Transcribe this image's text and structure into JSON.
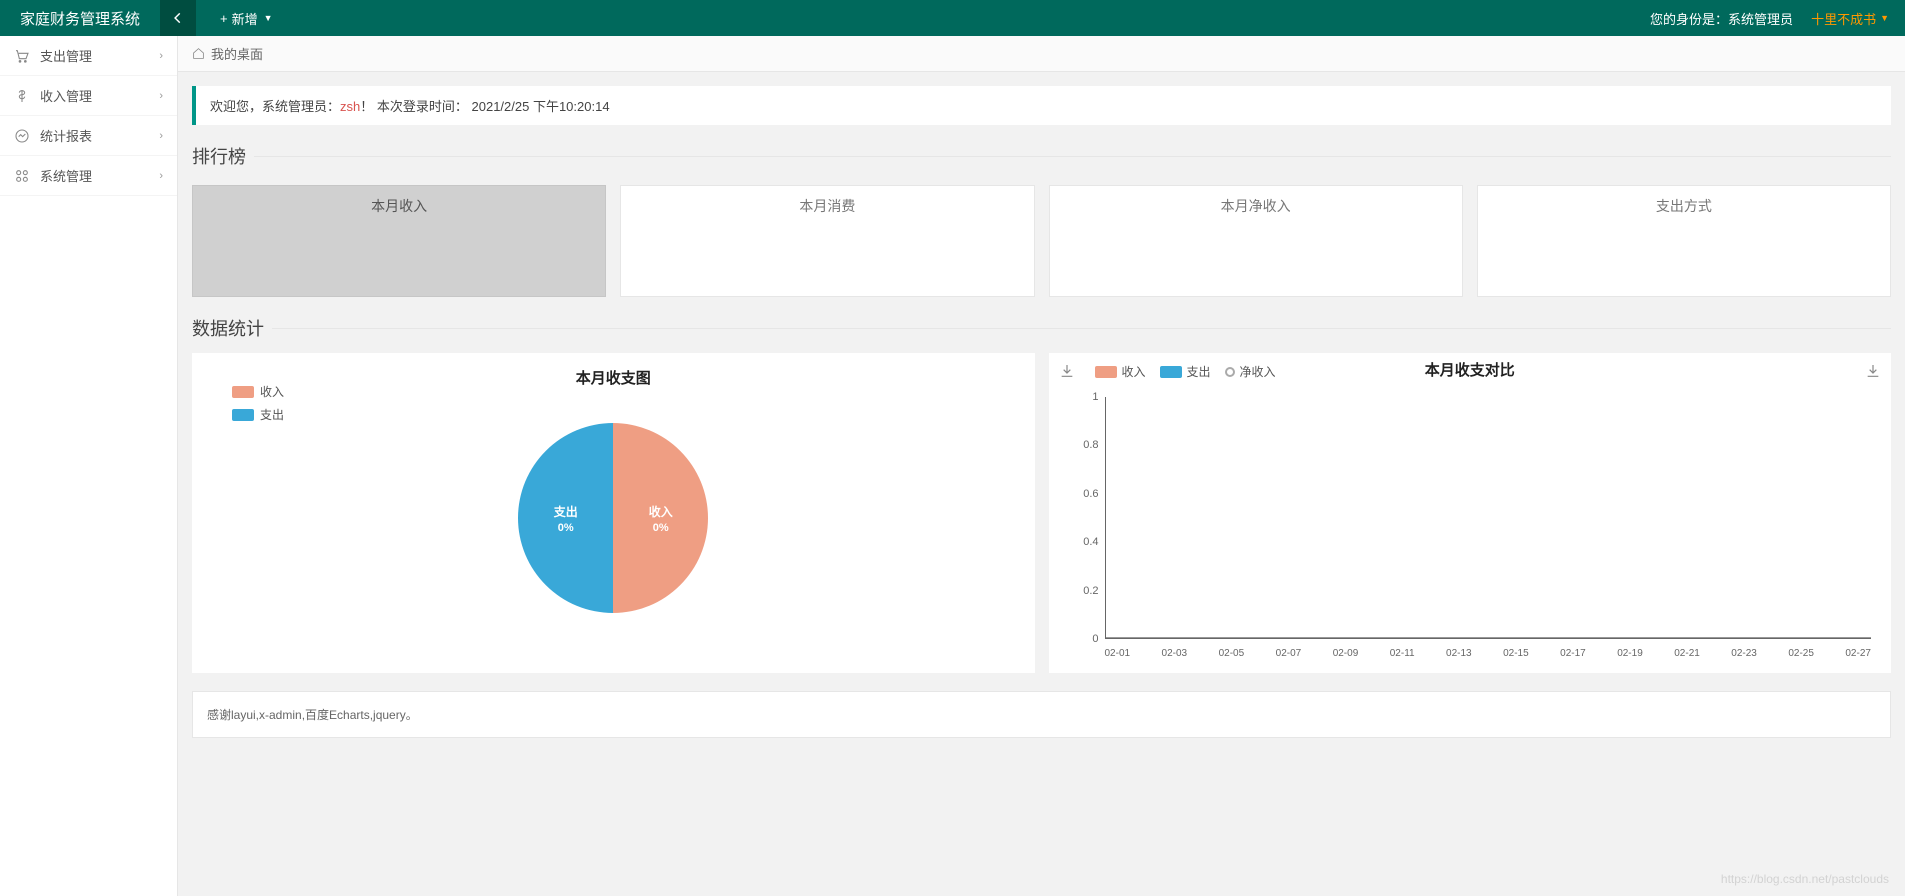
{
  "header": {
    "app_title": "家庭财务管理系统",
    "add_label": "新增",
    "role_prefix": "您的身份是：",
    "role": "系统管理员",
    "username": "十里不成书"
  },
  "sidebar": {
    "items": [
      {
        "label": "支出管理"
      },
      {
        "label": "收入管理"
      },
      {
        "label": "统计报表"
      },
      {
        "label": "系统管理"
      }
    ]
  },
  "breadcrumb": {
    "label": "我的桌面"
  },
  "welcome": {
    "prefix": "欢迎您，系统管理员：",
    "user": "zsh",
    "suffix": "！ 本次登录时间：",
    "time": "2021/2/25 下午10:20:14"
  },
  "ranking": {
    "legend": "排行榜",
    "cards": [
      {
        "title": "本月收入"
      },
      {
        "title": "本月消费"
      },
      {
        "title": "本月净收入"
      },
      {
        "title": "支出方式"
      }
    ]
  },
  "stats": {
    "legend": "数据统计"
  },
  "chart_data": [
    {
      "type": "pie",
      "title": "本月收支图",
      "series": [
        {
          "name": "收入",
          "value": 0,
          "percent": "0%",
          "color": "#ef9e83"
        },
        {
          "name": "支出",
          "value": 0,
          "percent": "0%",
          "color": "#39a8d8"
        }
      ]
    },
    {
      "type": "line",
      "title": "本月收支对比",
      "legend": [
        "收入",
        "支出",
        "净收入"
      ],
      "legend_colors": [
        "#ef9e83",
        "#39a8d8",
        "#aaaaaa"
      ],
      "x": [
        "02-01",
        "02-03",
        "02-05",
        "02-07",
        "02-09",
        "02-11",
        "02-13",
        "02-15",
        "02-17",
        "02-19",
        "02-21",
        "02-23",
        "02-25",
        "02-27"
      ],
      "ylim": [
        0,
        1
      ],
      "yticks": [
        0,
        0.2,
        0.4,
        0.6,
        0.8,
        1
      ],
      "series": [
        {
          "name": "收入",
          "values": [
            0,
            0,
            0,
            0,
            0,
            0,
            0,
            0,
            0,
            0,
            0,
            0,
            0,
            0
          ]
        },
        {
          "name": "支出",
          "values": [
            0,
            0,
            0,
            0,
            0,
            0,
            0,
            0,
            0,
            0,
            0,
            0,
            0,
            0
          ]
        },
        {
          "name": "净收入",
          "values": [
            0,
            0,
            0,
            0,
            0,
            0,
            0,
            0,
            0,
            0,
            0,
            0,
            0,
            0
          ]
        }
      ]
    }
  ],
  "footer": {
    "text": "感谢layui,x-admin,百度Echarts,jquery。"
  },
  "watermark": "https://blog.csdn.net/pastclouds"
}
